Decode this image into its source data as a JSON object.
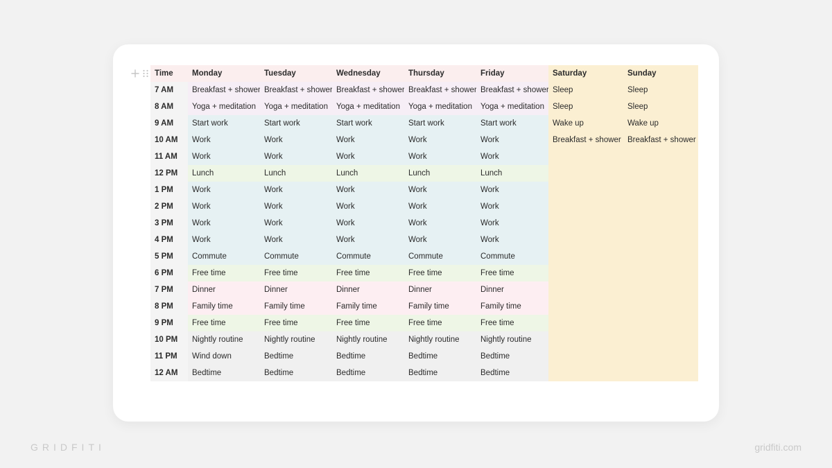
{
  "brand_left": "GRIDFITI",
  "brand_right": "gridfiti.com",
  "colors": {
    "header_weekday": "#fbeeee",
    "header_weekend": "#fbefd2",
    "weekend_fill": "#fbefd2",
    "work": "#e6f1f3",
    "meal": "#eef6e6",
    "personal": "#fdeef2",
    "night": "#f0f0f0"
  },
  "schedule": {
    "headers": [
      "Time",
      "Monday",
      "Tuesday",
      "Wednesday",
      "Thursday",
      "Friday",
      "Saturday",
      "Sunday"
    ],
    "rows": [
      {
        "time": "7 AM",
        "cells": [
          "Breakfast + shower",
          "Breakfast + shower",
          "Breakfast + shower",
          "Breakfast + shower",
          "Breakfast + shower",
          "Sleep",
          "Sleep"
        ]
      },
      {
        "time": "8 AM",
        "cells": [
          "Yoga + meditation",
          "Yoga + meditation",
          "Yoga + meditation",
          "Yoga + meditation",
          "Yoga + meditation",
          "Sleep",
          "Sleep"
        ]
      },
      {
        "time": "9 AM",
        "cells": [
          "Start work",
          "Start work",
          "Start work",
          "Start work",
          "Start work",
          "Wake up",
          "Wake up"
        ]
      },
      {
        "time": "10 AM",
        "cells": [
          "Work",
          "Work",
          "Work",
          "Work",
          "Work",
          "Breakfast + shower",
          "Breakfast + shower"
        ]
      },
      {
        "time": "11 AM",
        "cells": [
          "Work",
          "Work",
          "Work",
          "Work",
          "Work",
          "",
          ""
        ]
      },
      {
        "time": "12 PM",
        "cells": [
          "Lunch",
          "Lunch",
          "Lunch",
          "Lunch",
          "Lunch",
          "",
          ""
        ]
      },
      {
        "time": "1 PM",
        "cells": [
          "Work",
          "Work",
          "Work",
          "Work",
          "Work",
          "",
          ""
        ]
      },
      {
        "time": "2 PM",
        "cells": [
          "Work",
          "Work",
          "Work",
          "Work",
          "Work",
          "",
          ""
        ]
      },
      {
        "time": "3 PM",
        "cells": [
          "Work",
          "Work",
          "Work",
          "Work",
          "Work",
          "",
          ""
        ]
      },
      {
        "time": "4 PM",
        "cells": [
          "Work",
          "Work",
          "Work",
          "Work",
          "Work",
          "",
          ""
        ]
      },
      {
        "time": "5 PM",
        "cells": [
          "Commute",
          "Commute",
          "Commute",
          "Commute",
          "Commute",
          "",
          ""
        ]
      },
      {
        "time": "6 PM",
        "cells": [
          "Free time",
          "Free time",
          "Free time",
          "Free time",
          "Free time",
          "",
          ""
        ]
      },
      {
        "time": "7 PM",
        "cells": [
          "Dinner",
          "Dinner",
          "Dinner",
          "Dinner",
          "Dinner",
          "",
          ""
        ]
      },
      {
        "time": "8 PM",
        "cells": [
          "Family time",
          "Family time",
          "Family time",
          "Family time",
          "Family time",
          "",
          ""
        ]
      },
      {
        "time": "9 PM",
        "cells": [
          "Free time",
          "Free time",
          "Free time",
          "Free time",
          "Free time",
          "",
          ""
        ]
      },
      {
        "time": "10 PM",
        "cells": [
          "Nightly routine",
          "Nightly routine",
          "Nightly routine",
          "Nightly routine",
          "Nightly routine",
          "",
          ""
        ]
      },
      {
        "time": "11 PM",
        "cells": [
          "Wind down",
          "Bedtime",
          "Bedtime",
          "Bedtime",
          "Bedtime",
          "",
          ""
        ]
      },
      {
        "time": "12 AM",
        "cells": [
          "Bedtime",
          "Bedtime",
          "Bedtime",
          "Bedtime",
          "Bedtime",
          "",
          ""
        ]
      }
    ]
  }
}
